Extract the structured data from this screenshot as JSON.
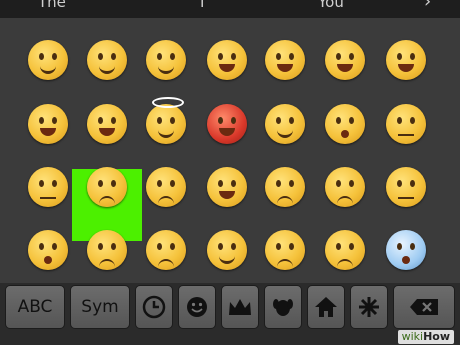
{
  "suggestions": {
    "left": "The",
    "middle": "I",
    "right": "You"
  },
  "emoji_rows": [
    [
      "smiling-face",
      "smiling-eyes-face",
      "blushing-face",
      "grinning-face",
      "sweat-smile-face",
      "grinning-face-big",
      "laughing-face"
    ],
    [
      "tears-of-joy-face",
      "squinting-grin-face",
      "angel-face",
      "devil-face",
      "winking-face",
      "surprised-face",
      "neutral-face"
    ],
    [
      "expressionless-face",
      "confused-face",
      "pouting-face",
      "grimacing-face",
      "angry-face",
      "crying-face",
      "sleeping-face"
    ],
    [
      "hushed-face",
      "tired-face",
      "persevering-face",
      "relieved-face",
      "frowning-face",
      "disappointed-face",
      "fearful-face"
    ]
  ],
  "selected_emoji": "confused-face",
  "keyboard": {
    "abc_label": "ABC",
    "sym_label": "Sym",
    "recent_icon": "clock-icon",
    "smiley_icon": "smiley-icon",
    "crown_icon": "crown-icon",
    "dog_icon": "dog-icon",
    "house_icon": "house-icon",
    "symbol_icon": "asterisk-icon",
    "backspace_icon": "backspace-icon"
  },
  "watermark": {
    "prefix": "wiki",
    "brand": "How"
  },
  "colors": {
    "highlight": "#4cf000",
    "key": "#5e5e5e",
    "background": "#3b3b3b"
  }
}
